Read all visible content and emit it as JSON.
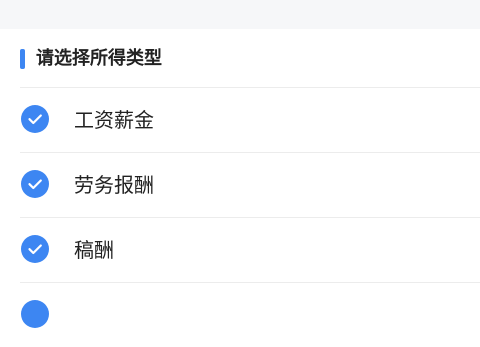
{
  "section": {
    "title": "请选择所得类型"
  },
  "options": [
    {
      "label": "工资薪金",
      "checked": true
    },
    {
      "label": "劳务报酬",
      "checked": true
    },
    {
      "label": "稿酬",
      "checked": true
    }
  ],
  "colors": {
    "accent": "#3d86f2",
    "background_band": "#f6f7f9",
    "text": "#222222",
    "divider": "#ececec"
  },
  "icons": {
    "check": "check-circle-icon"
  }
}
